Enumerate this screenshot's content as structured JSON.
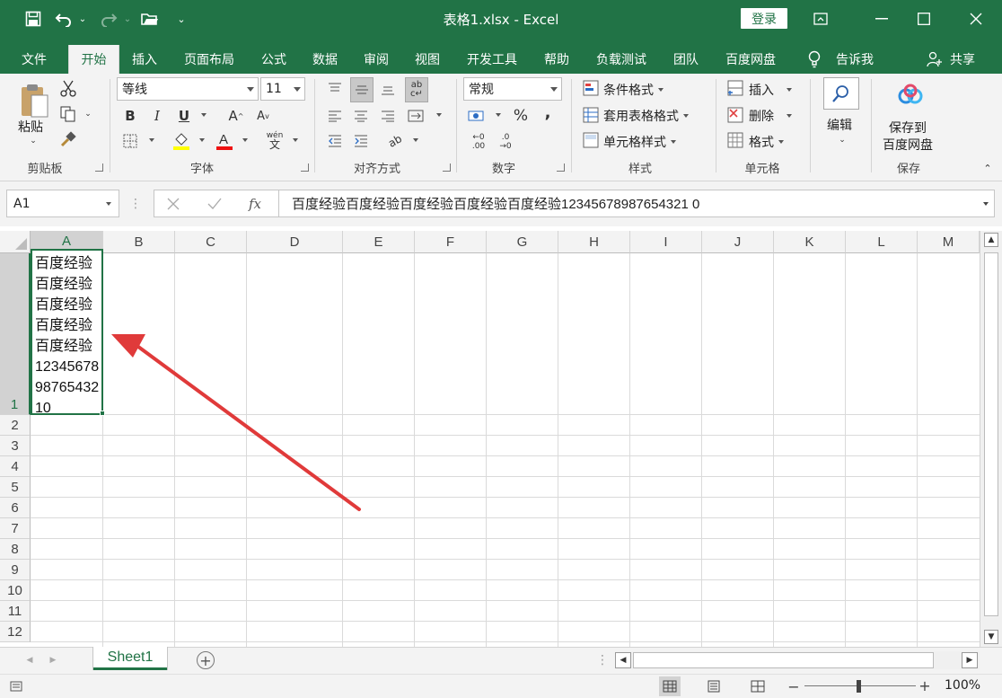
{
  "titlebar": {
    "title": "表格1.xlsx  -  Excel",
    "login_label": "登录"
  },
  "tabs": [
    {
      "label": "文件"
    },
    {
      "label": "开始"
    },
    {
      "label": "插入"
    },
    {
      "label": "页面布局"
    },
    {
      "label": "公式"
    },
    {
      "label": "数据"
    },
    {
      "label": "审阅"
    },
    {
      "label": "视图"
    },
    {
      "label": "开发工具"
    },
    {
      "label": "帮助"
    },
    {
      "label": "负载测试"
    },
    {
      "label": "团队"
    },
    {
      "label": "百度网盘"
    },
    {
      "label": "告诉我"
    },
    {
      "label": "共享"
    }
  ],
  "ribbon": {
    "clipboard": {
      "paste_label": "粘贴",
      "group_label": "剪贴板"
    },
    "font": {
      "font_name": "等线",
      "font_size": "11",
      "group_label": "字体",
      "bold": "B",
      "italic": "I",
      "underline": "U",
      "phonetic": "wén"
    },
    "alignment": {
      "group_label": "对齐方式"
    },
    "number": {
      "format": "常规",
      "percent": "%",
      "comma": ",",
      "group_label": "数字",
      "inc_decimal": ".00",
      "dec_decimal": ".0"
    },
    "styles": {
      "conditional": "条件格式",
      "table_format": "套用表格格式",
      "cell_style": "单元格样式",
      "group_label": "样式"
    },
    "cells": {
      "insert": "插入",
      "delete": "删除",
      "format": "格式",
      "group_label": "单元格"
    },
    "editing": {
      "label": "编辑"
    },
    "save": {
      "label_line1": "保存到",
      "label_line2": "百度网盘",
      "group_label": "保存"
    }
  },
  "formula_bar": {
    "name_box": "A1",
    "fx": "fx",
    "content": "百度经验百度经验百度经验百度经验百度经验12345678987654321 0"
  },
  "grid": {
    "columns": [
      "A",
      "B",
      "C",
      "D",
      "E",
      "F",
      "G",
      "H",
      "I",
      "J",
      "K",
      "L",
      "M"
    ],
    "rows": [
      "1",
      "2",
      "3",
      "4",
      "5",
      "6",
      "7",
      "8",
      "9",
      "10",
      "11",
      "12"
    ],
    "cell_a1_lines": [
      "百度经验",
      "百度经验",
      "百度经验",
      "百度经验",
      "百度经验",
      "12345678",
      "98765432",
      "10"
    ]
  },
  "sheets": {
    "active": "Sheet1"
  },
  "status": {
    "zoom": "100%"
  },
  "annotation": {
    "arrow_color": "#e03a3a"
  },
  "colors": {
    "excel_green": "#217346"
  }
}
